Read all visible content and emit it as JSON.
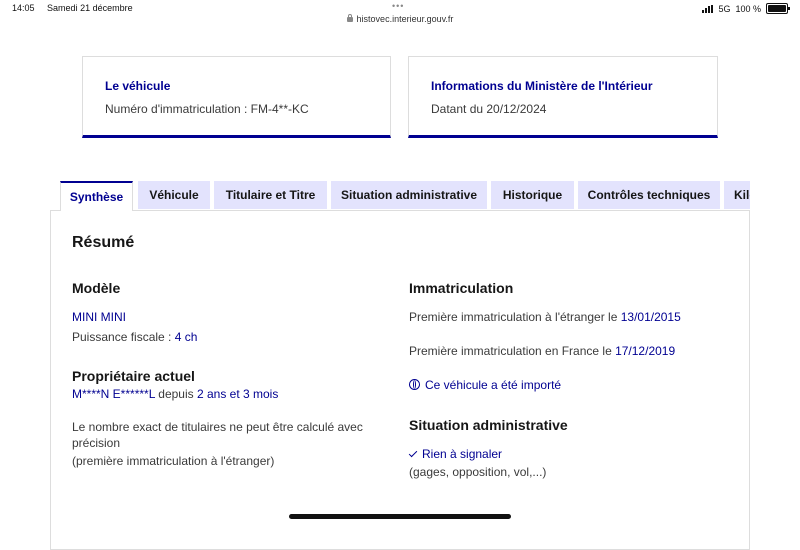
{
  "status_bar": {
    "time": "14:05",
    "date": "Samedi 21 décembre",
    "network": "5G",
    "battery": "100 %",
    "url": "histovec.interieur.gouv.fr"
  },
  "cards": {
    "vehicle": {
      "title": "Le véhicule",
      "text": "Numéro d'immatriculation : FM-4**-KC"
    },
    "ministry": {
      "title": "Informations du Ministère de l'Intérieur",
      "text": "Datant du 20/12/2024"
    }
  },
  "tabs": [
    {
      "label": "Synthèse",
      "active": true
    },
    {
      "label": "Véhicule"
    },
    {
      "label": "Titulaire et Titre"
    },
    {
      "label": "Situation administrative"
    },
    {
      "label": "Historique"
    },
    {
      "label": "Contrôles techniques"
    },
    {
      "label": "Kilométrage"
    }
  ],
  "summary": {
    "heading": "Résumé",
    "model": {
      "heading": "Modèle",
      "name": "MINI MINI",
      "power_label": "Puissance fiscale : ",
      "power_value": "4 ch"
    },
    "owner": {
      "heading": "Propriétaire actuel",
      "name": "M****N E******L",
      "since_label": " depuis ",
      "since_value": "2 ans et 3 mois",
      "note_line1": "Le nombre exact de titulaires ne peut être calculé avec",
      "note_line2": "précision",
      "note_line3": "(première immatriculation à l'étranger)"
    },
    "registration": {
      "heading": "Immatriculation",
      "foreign_label": "Première immatriculation à l'étranger le ",
      "foreign_date": "13/01/2015",
      "france_label": "Première immatriculation en France le ",
      "france_date": "17/12/2019",
      "imported_link": "Ce véhicule a été importé"
    },
    "admin": {
      "heading": "Situation administrative",
      "status": "Rien à signaler",
      "details": "(gages, opposition, vol,...)"
    }
  }
}
